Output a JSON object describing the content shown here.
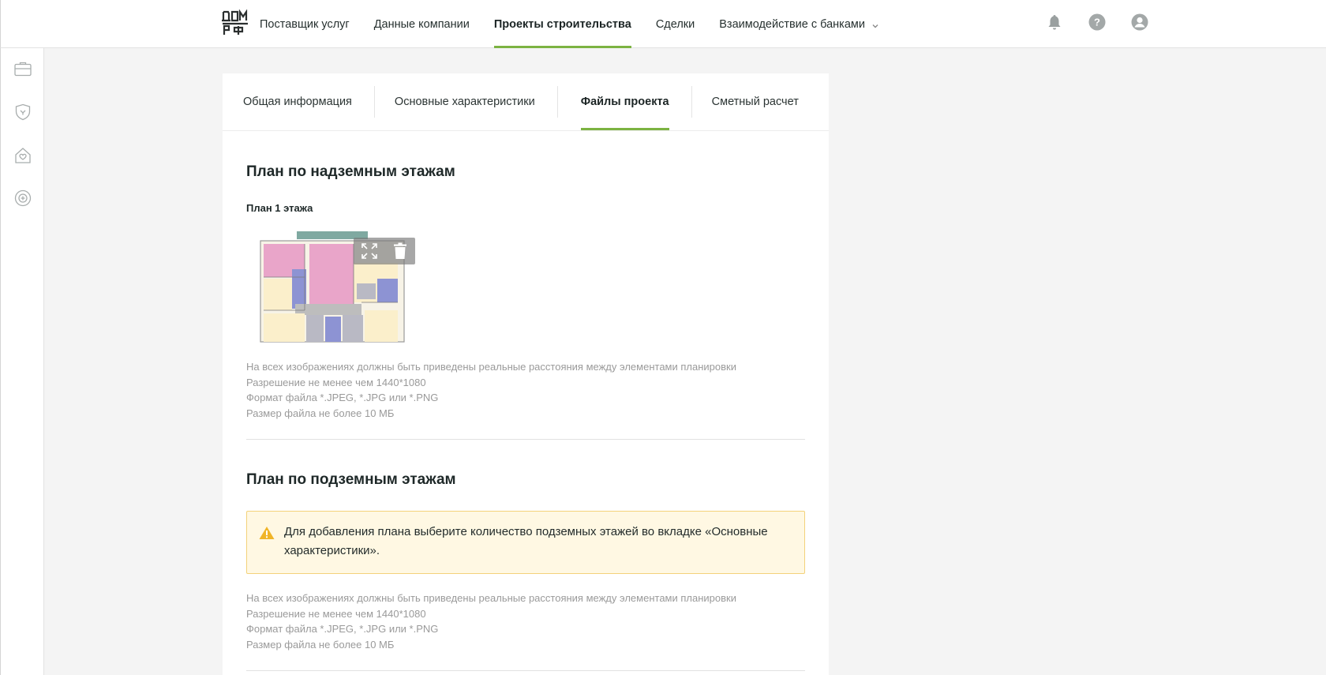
{
  "header": {
    "logo_text_top": "ДОМ",
    "logo_text_bottom": "РФ",
    "nav": [
      {
        "label": "Поставщик услуг"
      },
      {
        "label": "Данные компании"
      },
      {
        "label": "Проекты строительства"
      },
      {
        "label": "Сделки"
      },
      {
        "label": "Взаимодействие с банками"
      }
    ],
    "icons": [
      "bell-icon",
      "help-icon",
      "user-icon"
    ]
  },
  "sidebar": {
    "icons": [
      "briefcase-icon",
      "shield-icon",
      "house-heart-icon",
      "badge-icon"
    ]
  },
  "tabs": [
    {
      "label": "Общая информация"
    },
    {
      "label": "Основные характеристики"
    },
    {
      "label": "Файлы проекта"
    },
    {
      "label": "Сметный расчет"
    }
  ],
  "active_tab": "Файлы проекта",
  "section_above": {
    "title": "План по надземным этажам",
    "subtitle": "План 1 этажа",
    "hints": [
      "На всех изображениях должны быть приведены реальные расстояния между элементами планировки",
      "Разрешение не менее чем 1440*1080",
      "Формат файла *.JPEG, *.JPG или *.PNG",
      "Размер файла не более 10 МБ"
    ]
  },
  "section_below": {
    "title": "План по подземным этажам",
    "alert": "Для добавления плана выберите количество подземных этажей во вкладке «Основные характеристики».",
    "hints": [
      "На всех изображениях должны быть приведены реальные расстояния между элементами планировки",
      "Разрешение не менее чем 1440*1080",
      "Формат файла *.JPEG, *.JPG или *.PNG",
      "Размер файла не более 10 МБ"
    ]
  },
  "colors": {
    "accent": "#7cb342",
    "alert_bg": "#fff8e3",
    "alert_border": "#f3d27a",
    "warning": "#f0b428"
  }
}
